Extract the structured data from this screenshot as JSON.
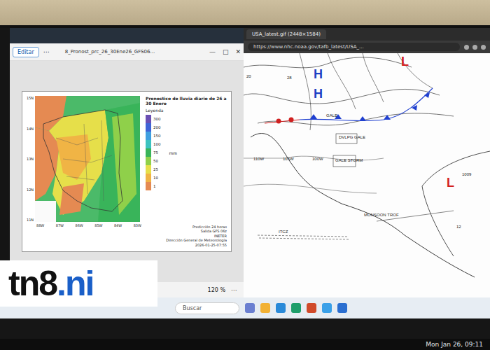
{
  "left_window": {
    "edit_button": "Editar",
    "more": "⋯",
    "title": "8_Pronost_prc_26_30Ene26_GFS06...",
    "controls": [
      "—",
      "□",
      "✕"
    ],
    "chart": {
      "title": "Pronostico de lluvia diario de 26 a 30 Enero",
      "legend_title": "Leyenda",
      "unit": "mm",
      "scale": [
        {
          "value": "300",
          "color": "#6b4fb3"
        },
        {
          "value": "200",
          "color": "#3f63d6"
        },
        {
          "value": "150",
          "color": "#3f9fe0"
        },
        {
          "value": "100",
          "color": "#3cc3c0"
        },
        {
          "value": "75",
          "color": "#39b45a"
        },
        {
          "value": "50",
          "color": "#8fd04a"
        },
        {
          "value": "25",
          "color": "#e6df4a"
        },
        {
          "value": "10",
          "color": "#f0b445"
        },
        {
          "value": "1",
          "color": "#e58a52"
        }
      ],
      "lat_ticks": [
        "15N",
        "14N",
        "13N",
        "12N",
        "11N"
      ],
      "lon_ticks": [
        "88W",
        "87W",
        "86W",
        "85W",
        "84W",
        "83W"
      ],
      "footer": [
        "Predicción 24 horas",
        "Salida GFS 06z",
        "INETER",
        "Dirección General de Meteorología"
      ],
      "timestamp": "2026-01-25-07:55"
    },
    "zoom": "120 %",
    "zoom_more": "⋯"
  },
  "right_window": {
    "tab": "USA_latest.gif (2448×1584)",
    "url": "https://www.nhc.noaa.gov/tafb_latest/USA_...",
    "map_labels": [
      {
        "text": "H",
        "color": "#1d3fc4"
      },
      {
        "text": "H",
        "color": "#1d3fc4"
      },
      {
        "text": "L",
        "color": "#d3201f"
      },
      {
        "text": "L",
        "color": "#d3201f"
      },
      {
        "text": "GALE",
        "color": "#222222"
      },
      {
        "text": "DVLPG GALE",
        "color": "#222222"
      },
      {
        "text": "GALE STORM",
        "color": "#222222"
      },
      {
        "text": "MONSOON TROF",
        "color": "#222222"
      },
      {
        "text": "ITCZ",
        "color": "#222222"
      },
      {
        "text": "1009",
        "color": "#222222"
      },
      {
        "text": "12",
        "color": "#222222"
      },
      {
        "text": "20",
        "color": "#222222"
      },
      {
        "text": "28",
        "color": "#222222"
      },
      {
        "text": "110W",
        "color": "#222222"
      },
      {
        "text": "105W",
        "color": "#222222"
      },
      {
        "text": "100W",
        "color": "#222222"
      }
    ]
  },
  "taskbar": {
    "search": "Buscar"
  },
  "clock": "Mon Jan 26, 09:11",
  "logo": {
    "main": "tn8",
    "suffix": ".ni"
  }
}
